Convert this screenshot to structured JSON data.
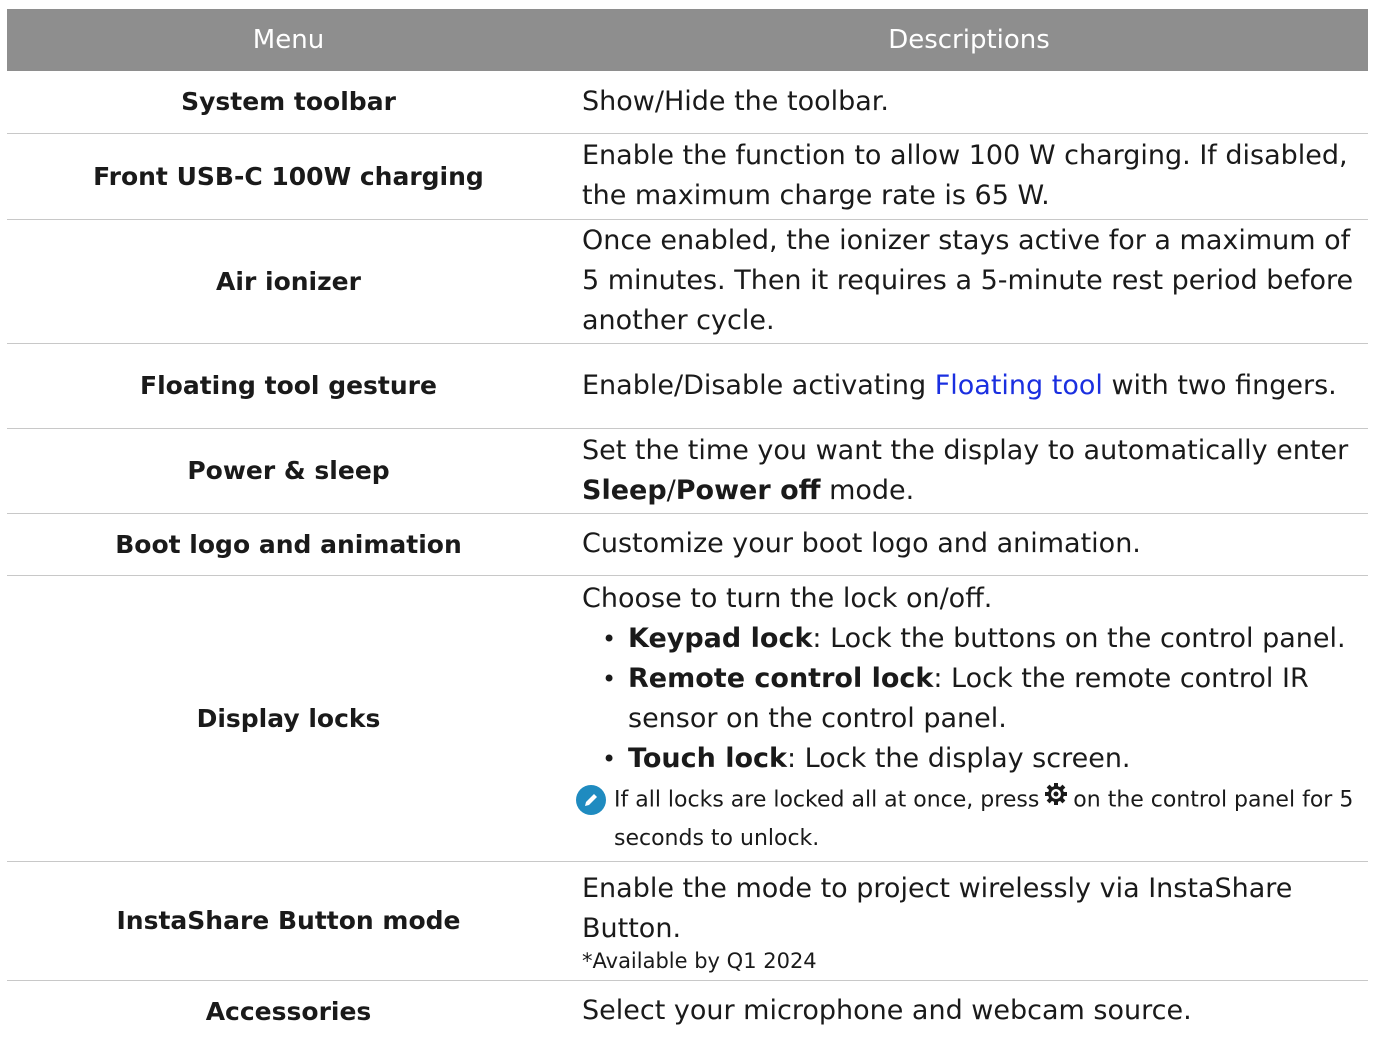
{
  "header": {
    "menu": "Menu",
    "descriptions": "Descriptions"
  },
  "rows": [
    {
      "menu": "System toolbar",
      "desc": "Show/Hide the toolbar."
    },
    {
      "menu": "Front USB-C 100W charging",
      "desc": "Enable the function to allow 100 W charging. If disabled, the maximum charge rate is 65 W."
    },
    {
      "menu": "Air ionizer",
      "desc": "Once enabled, the ionizer stays active for a maximum of 5 minutes. Then it requires a 5-minute rest period before another cycle."
    },
    {
      "menu": "Floating tool gesture",
      "desc_pre": "Enable/Disable activating ",
      "desc_link": "Floating tool",
      "desc_post": " with two fingers."
    },
    {
      "menu": "Power & sleep",
      "desc_pre": "Set the time you want the display to automatically enter ",
      "b1": "Sleep",
      "sep": "/",
      "b2": "Power off",
      "desc_post": " mode."
    },
    {
      "menu": "Boot logo and animation",
      "desc": "Customize your boot logo and animation."
    },
    {
      "menu": "Display locks",
      "desc": "Choose to turn the lock on/off.",
      "bullet_glyph": "•",
      "bullets": [
        {
          "bold": "Keypad lock",
          "text": ": Lock the buttons on the control panel."
        },
        {
          "bold": "Remote control lock",
          "text": ": Lock the remote control IR sensor on the control panel."
        },
        {
          "bold": "Touch lock",
          "text": ": Lock the display screen."
        }
      ],
      "note_pre": "If all locks are locked all at once, press",
      "note_post": "on the control panel for 5 seconds to unlock.",
      "note_icon": "pencil-icon",
      "gear_icon": "gear-icon"
    },
    {
      "menu": "InstaShare Button mode",
      "desc": "Enable the mode to project wirelessly via InstaShare Button.",
      "sub": "*Available by Q1 2024"
    },
    {
      "menu": "Accessories",
      "desc": "Select your microphone and webcam source."
    }
  ],
  "colors": {
    "header_bg": "#8e8e8e",
    "link": "#1a2fe0",
    "note_icon": "#1f8bc0"
  }
}
